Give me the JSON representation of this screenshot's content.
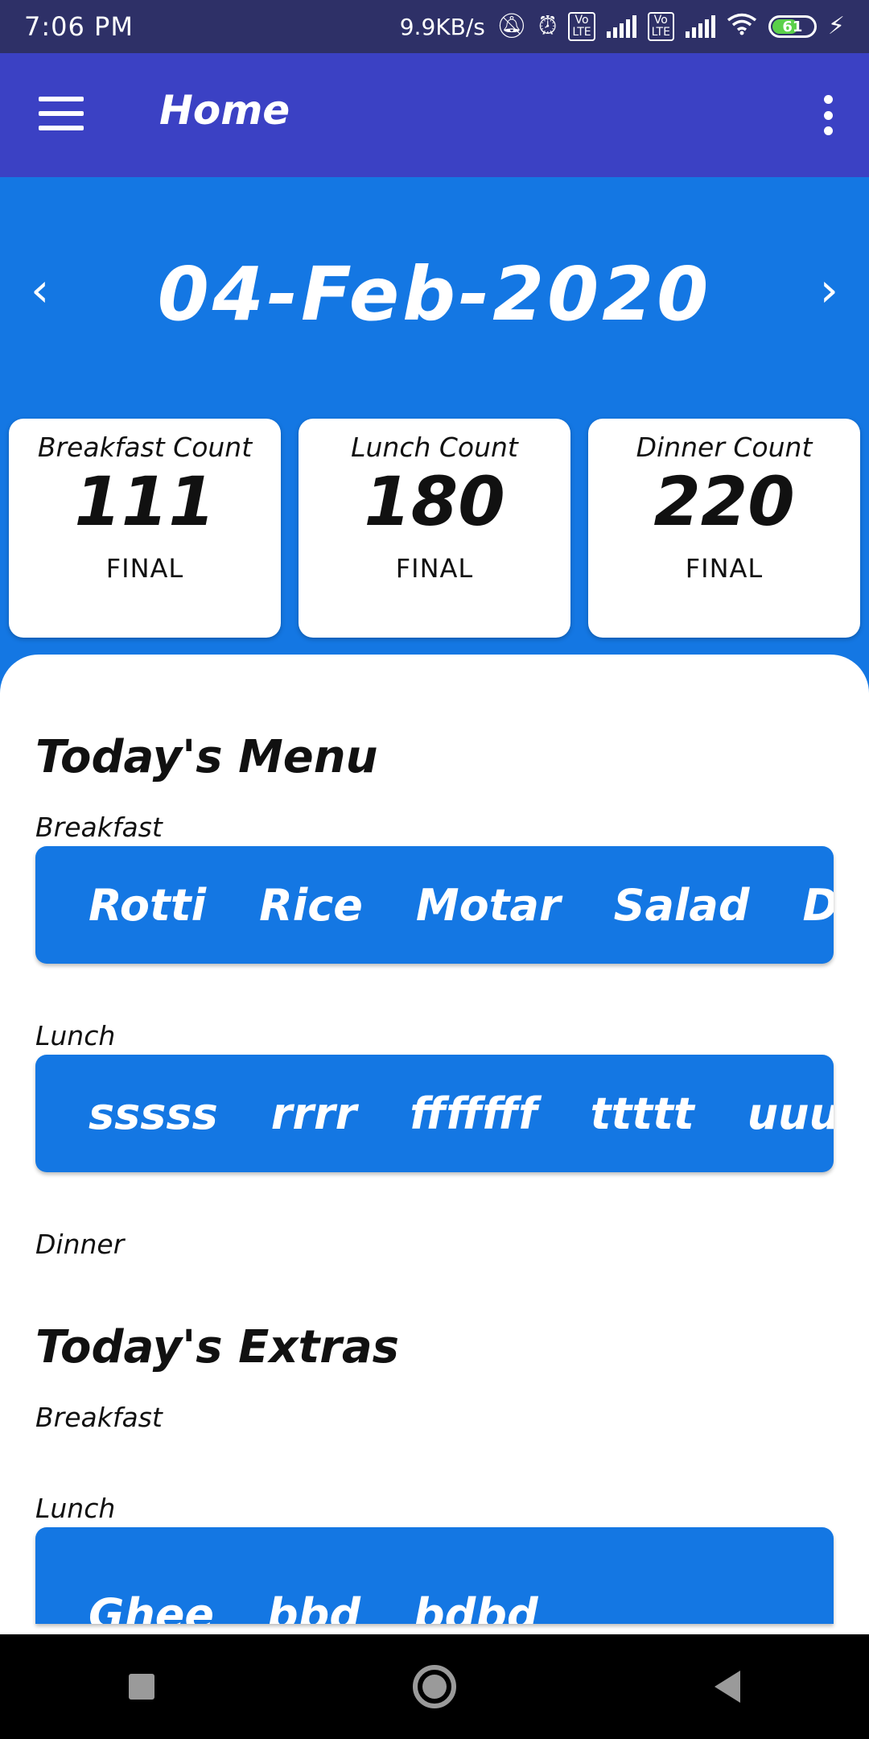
{
  "status_bar": {
    "time": "7:06 PM",
    "speed": "9.9KB/s",
    "battery": "61"
  },
  "app_bar": {
    "title": "Home"
  },
  "date_nav": {
    "prev": "‹",
    "date": "04-Feb-2020",
    "next": "›"
  },
  "counts": [
    {
      "label": "Breakfast Count",
      "value": "111",
      "status": "FINAL"
    },
    {
      "label": "Lunch Count",
      "value": "180",
      "status": "FINAL"
    },
    {
      "label": "Dinner Count",
      "value": "220",
      "status": "FINAL"
    }
  ],
  "menu": {
    "title": "Today's Menu",
    "breakfast_label": "Breakfast",
    "breakfast_items": [
      "Rotti",
      "Rice",
      "Motar",
      "Salad",
      "Dall"
    ],
    "lunch_label": "Lunch",
    "lunch_items": [
      "sssss",
      "rrrr",
      "fffffff",
      "ttttt",
      "uuuuuu"
    ],
    "dinner_label": "Dinner"
  },
  "extras": {
    "title": "Today's Extras",
    "breakfast_label": "Breakfast",
    "lunch_label": "Lunch",
    "lunch_items": [
      "Ghee",
      "bbd",
      "bdbd"
    ]
  },
  "colors": {
    "primary_blue": "#1477e3",
    "app_bar": "#3b41c4",
    "status_bar": "#2e3067"
  }
}
